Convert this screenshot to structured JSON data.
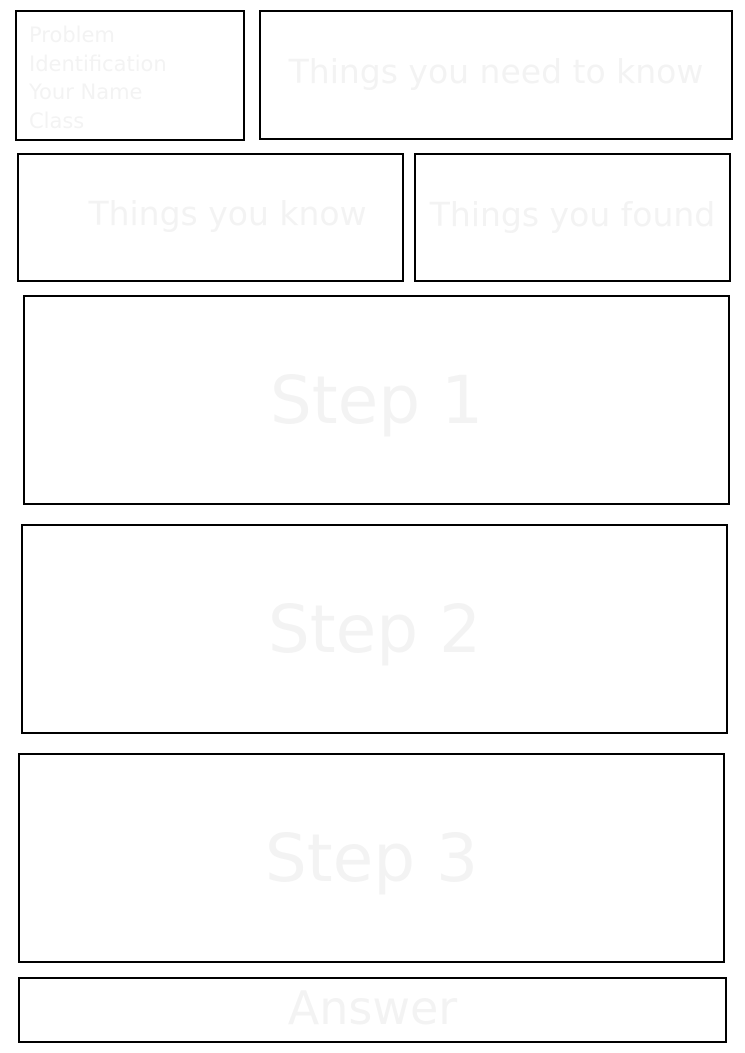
{
  "header": {
    "problem_lines": [
      "Problem",
      "Identification",
      "Your Name",
      "Class"
    ],
    "need_to_know": "Things you need to know"
  },
  "known": {
    "things_you_know": "Things you know",
    "things_you_found": "Things you found"
  },
  "steps": [
    {
      "label": "Step 1"
    },
    {
      "label": "Step 2"
    },
    {
      "label": "Step 3"
    }
  ],
  "answer": {
    "label": "Answer"
  },
  "colors": {
    "border": "#000000",
    "faint_text": "#f3f3f3",
    "background": "#ffffff"
  }
}
